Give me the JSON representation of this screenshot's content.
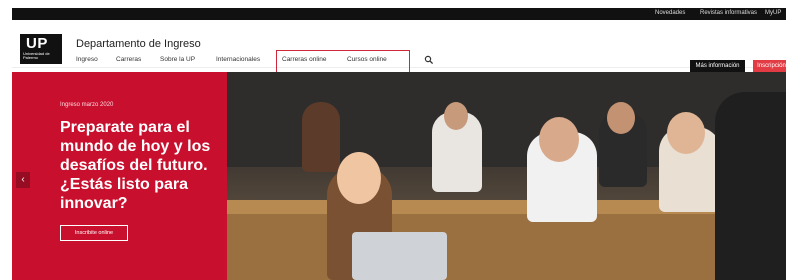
{
  "topbar": {
    "links": [
      "Novedades",
      "Revistas informativas",
      "MyUP"
    ]
  },
  "header": {
    "logo": {
      "big": "UP",
      "small": "Universidad de Palermo"
    },
    "department": "Departamento de Ingreso",
    "nav": [
      "Ingreso",
      "Carreras",
      "Sobre la UP",
      "Internacionales",
      "Carreras online",
      "Cursos online"
    ],
    "buttons": {
      "info": "Más información",
      "signup": "Inscripción"
    }
  },
  "hero": {
    "kicker": "Ingreso marzo 2020",
    "title": "Preparate para el mundo de hoy y los desafíos del futuro. ¿Estás listo para innovar?",
    "cta": "Inscribite online"
  },
  "icons": {
    "search": "search-icon",
    "prev": "chevron-left-icon"
  },
  "colors": {
    "brand_red": "#c8102e",
    "signup_button": "#e33b44",
    "dark": "#111111",
    "highlight": "#d0283a"
  }
}
